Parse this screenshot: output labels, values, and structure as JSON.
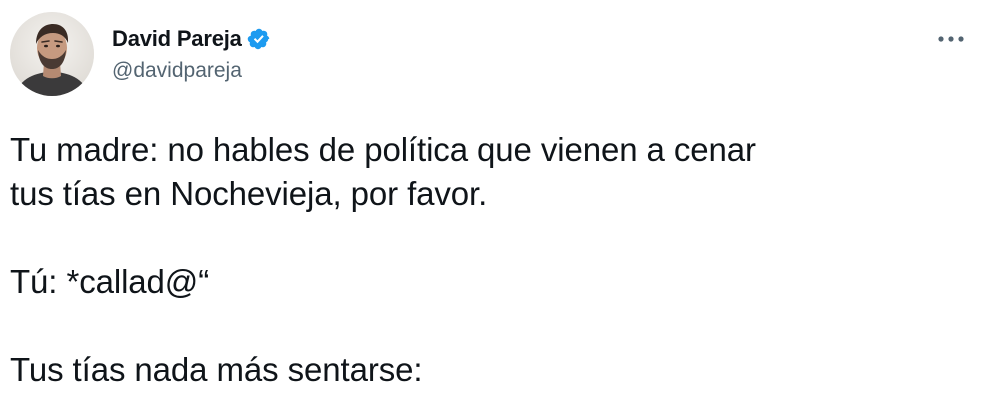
{
  "author": {
    "display_name": "David Pareja",
    "handle": "@davidpareja",
    "verified": true,
    "avatar_icon": "user-avatar-photo",
    "verified_icon": "verified-badge-icon",
    "verified_color": "#1d9bf0"
  },
  "menu": {
    "more_icon": "more-horizontal-icon"
  },
  "tweet": {
    "line_1": "Tu madre: no hables de política que vienen a cenar",
    "line_2": "tus tías en Nochevieja, por favor.",
    "line_3": "Tú: *callad@“",
    "line_4": "Tus tías nada más sentarse:"
  },
  "colors": {
    "text_primary": "#0f1419",
    "text_secondary": "#536471",
    "background": "#ffffff"
  }
}
